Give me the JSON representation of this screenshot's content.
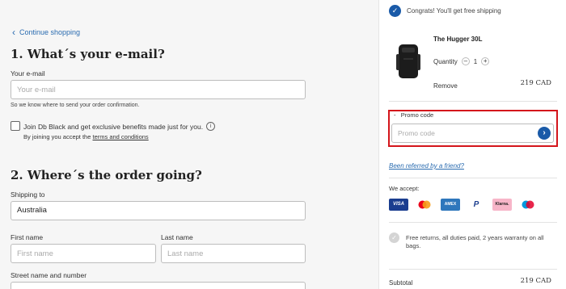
{
  "nav": {
    "continue_label": "Continue shopping"
  },
  "email_section": {
    "heading": "1. What´s your e-mail?",
    "field_label": "Your e-mail",
    "placeholder": "Your e-mail",
    "help_text": "So we know where to send your order confirmation.",
    "newsletter_label": "Join Db Black and get exclusive benefits made just for you.",
    "terms_prefix": "By joining you accept the ",
    "terms_link": "terms and conditions"
  },
  "shipping_section": {
    "heading": "2. Where´s the order going?",
    "shipping_to_label": "Shipping to",
    "shipping_to_value": "Australia",
    "first_name_label": "First name",
    "first_name_placeholder": "First name",
    "last_name_label": "Last name",
    "last_name_placeholder": "Last name",
    "street_label": "Street name and number"
  },
  "cart": {
    "free_shipping_text": "Congrats! You'll get free shipping",
    "item": {
      "name": "The Hugger 30L",
      "quantity_label": "Quantity",
      "quantity": "1",
      "remove_label": "Remove",
      "price": "219 CAD"
    },
    "promo": {
      "toggle_label": "Promo code",
      "placeholder": "Promo code"
    },
    "referral_link": "Been referred by a friend?",
    "accept_label": "We accept:",
    "payment_methods": [
      {
        "name": "Visa",
        "label": "VISA",
        "bg": "#1a3d8f",
        "fg": "#ffffff"
      },
      {
        "name": "Mastercard",
        "label": "",
        "bg": "#ffffff",
        "fg": "#000000"
      },
      {
        "name": "Amex",
        "label": "AMEX",
        "bg": "#2e77bc",
        "fg": "#ffffff"
      },
      {
        "name": "PayPal",
        "label": "P",
        "bg": "#ffffff",
        "fg": "#1d3f8f"
      },
      {
        "name": "Klarna",
        "label": "Klarna.",
        "bg": "#f7b5c8",
        "fg": "#222222"
      },
      {
        "name": "Maestro",
        "label": "",
        "bg": "#ffffff",
        "fg": "#000000"
      }
    ],
    "returns_text": "Free returns, all duties paid, 2 years warranty on all bags.",
    "subtotal_label": "Subtotal",
    "subtotal_value": "219 CAD"
  },
  "colors": {
    "accent": "#1a5aa8",
    "link": "#2b6cb0",
    "highlight": "#d4151b"
  }
}
